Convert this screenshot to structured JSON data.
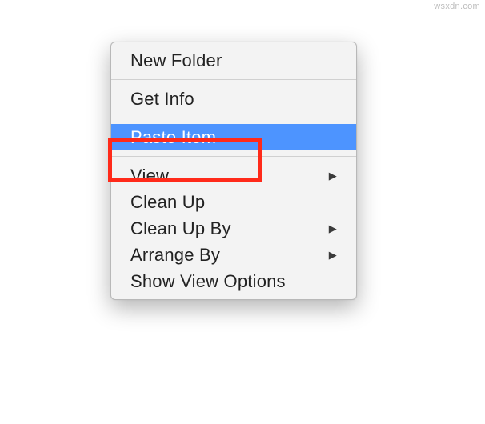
{
  "watermark": "wsxdn.com",
  "menu": {
    "items": [
      {
        "label": "New Folder",
        "has_submenu": false,
        "highlighted": false
      },
      {
        "separator": true
      },
      {
        "label": "Get Info",
        "has_submenu": false,
        "highlighted": false
      },
      {
        "separator": true
      },
      {
        "label": "Paste Item",
        "has_submenu": false,
        "highlighted": true
      },
      {
        "separator": true
      },
      {
        "label": "View",
        "has_submenu": true,
        "highlighted": false
      },
      {
        "label": "Clean Up",
        "has_submenu": false,
        "highlighted": false
      },
      {
        "label": "Clean Up By",
        "has_submenu": true,
        "highlighted": false
      },
      {
        "label": "Arrange By",
        "has_submenu": true,
        "highlighted": false
      },
      {
        "label": "Show View Options",
        "has_submenu": false,
        "highlighted": false
      }
    ]
  },
  "annotation": {
    "color": "#ff2a1a",
    "target": "Paste Item"
  }
}
